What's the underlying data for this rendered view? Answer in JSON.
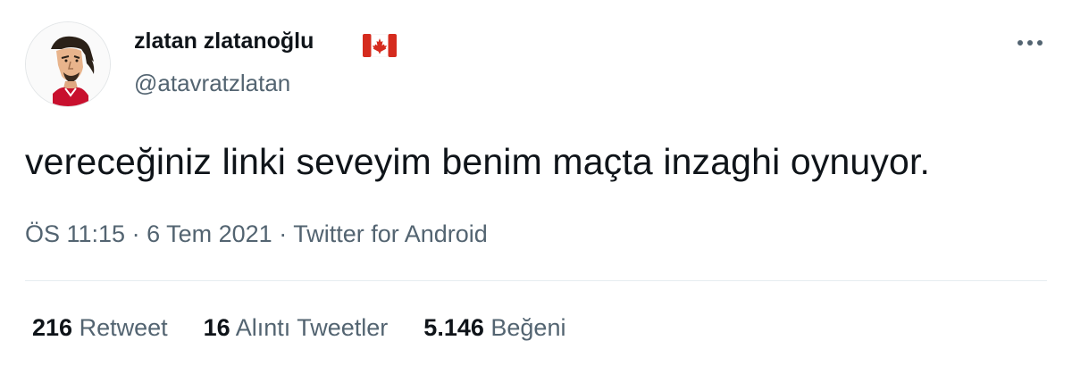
{
  "user": {
    "display_name": "zlatan zlatanoğlu",
    "flag_icon": "canada-flag-icon",
    "handle": "@atavratzlatan",
    "avatar_icon": "player-caricature-avatar"
  },
  "tweet": {
    "text": "vereceğiniz linki seveyim benim maçta inzaghi oynuyor."
  },
  "meta": {
    "time": "ÖS 11:15",
    "sep1": " · ",
    "date": "6 Tem 2021",
    "sep2": " · ",
    "source": "Twitter for Android"
  },
  "stats": [
    {
      "count": "216",
      "label": "Retweet"
    },
    {
      "count": "16",
      "label": "Alıntı Tweetler"
    },
    {
      "count": "5.146",
      "label": "Beğeni"
    }
  ],
  "colors": {
    "primary_text": "#0f1419",
    "secondary_text": "#536471",
    "divider": "#e6ecf0",
    "flag_red": "#d52b1e"
  },
  "icons": {
    "more": "more-horizontal-icon"
  }
}
